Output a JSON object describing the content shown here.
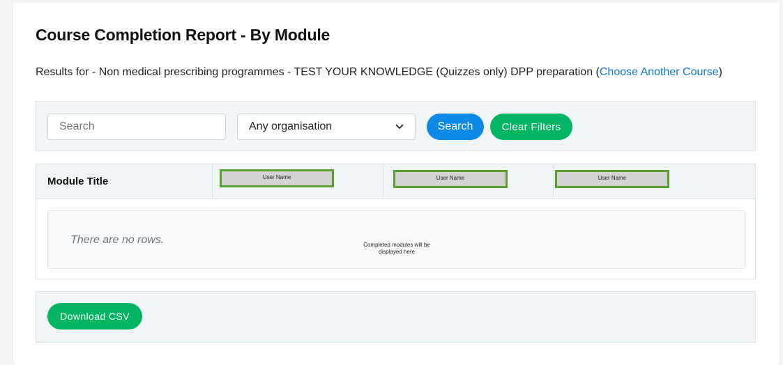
{
  "page": {
    "title": "Course Completion Report - By Module",
    "results_prefix": "Results for - Non medical prescribing programmes - TEST YOUR KNOWLEDGE (Quizzes only) DPP preparation (",
    "choose_link": "Choose Another Course",
    "results_suffix": ")"
  },
  "filters": {
    "search_placeholder": "Search",
    "organisation_selected": "Any organisation",
    "search_button": "Search",
    "clear_button": "Clear Filters"
  },
  "table": {
    "headers": {
      "module_title": "Module Title",
      "user_columns": [
        "User Name",
        "User Name",
        "User Name"
      ]
    },
    "empty_message": "There are no rows.",
    "annotation": "Completed modules will be displayed here"
  },
  "footer": {
    "download_button": "Download CSV"
  },
  "colors": {
    "primary": "#0d8ae6",
    "success": "#02b562",
    "link": "#0d77d8",
    "annotation_border": "#5a9e2f"
  },
  "icons": {
    "select_chevron": "chevron-down-icon"
  }
}
